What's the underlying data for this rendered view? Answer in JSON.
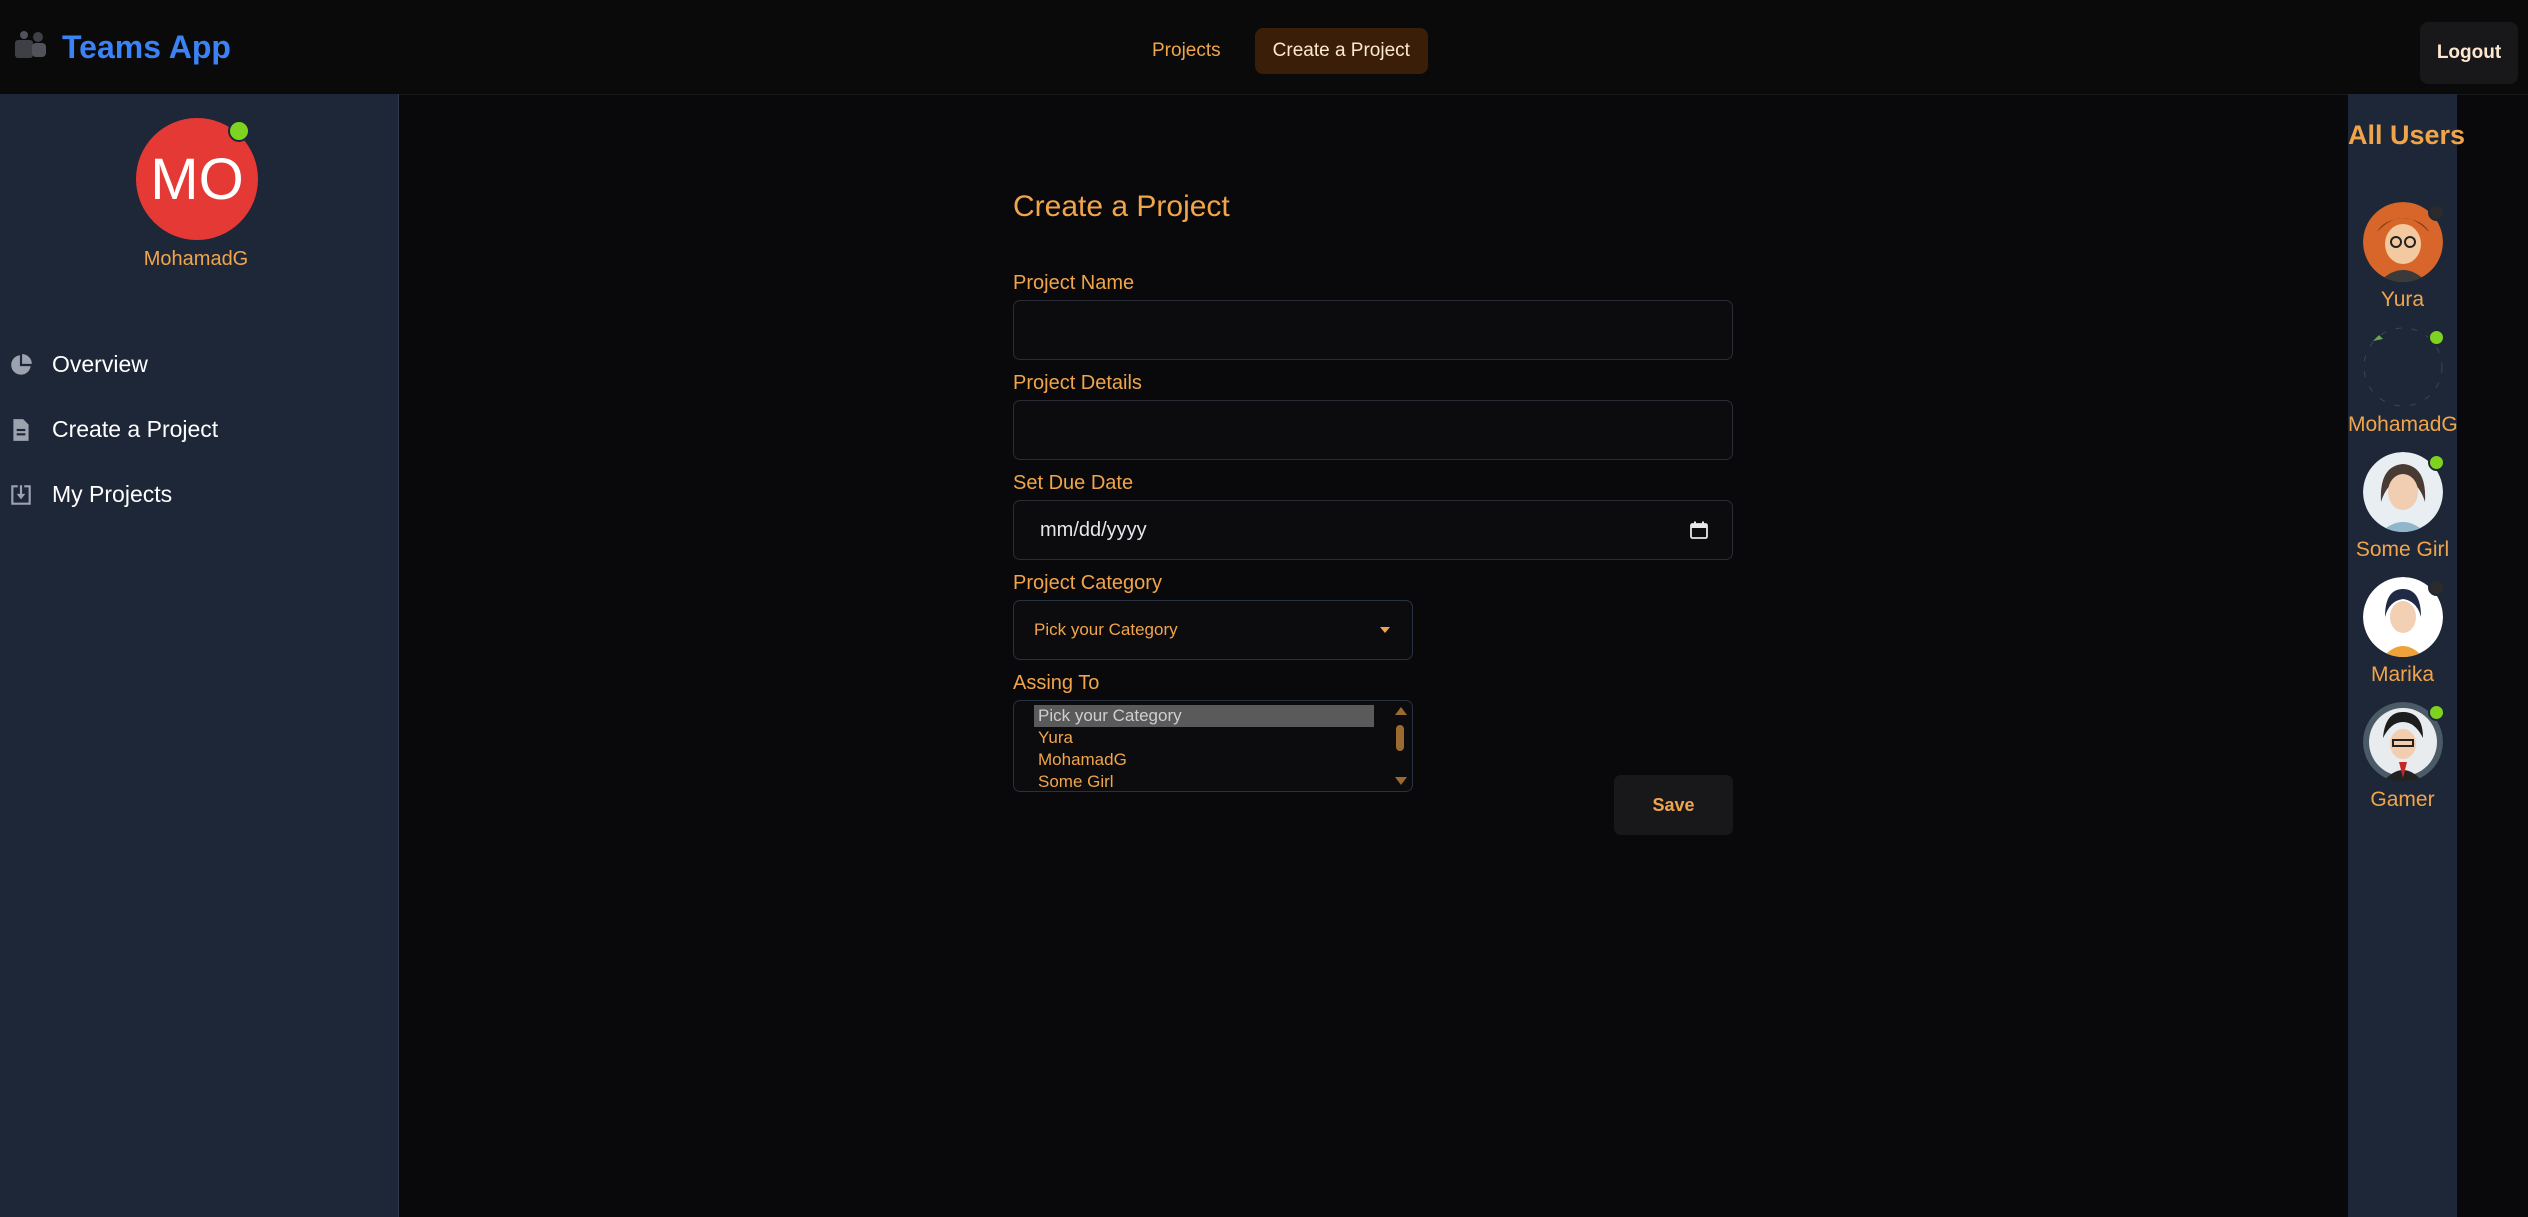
{
  "header": {
    "app_name": "Teams App",
    "nav": [
      {
        "label": "Projects",
        "active": false
      },
      {
        "label": "Create a Project",
        "active": true
      }
    ],
    "logout_label": "Logout"
  },
  "sidebar": {
    "avatar_initials": "MO",
    "avatar_color": "#e53935",
    "username": "MohamadG",
    "menu": [
      {
        "label": "Overview",
        "icon": "pie-chart-icon"
      },
      {
        "label": "Create a Project",
        "icon": "document-icon"
      },
      {
        "label": "My Projects",
        "icon": "inbox-download-icon"
      }
    ]
  },
  "form": {
    "title": "Create a Project",
    "project_name_label": "Project Name",
    "project_name_value": "",
    "project_details_label": "Project Details",
    "project_details_value": "",
    "due_date_label": "Set Due Date",
    "due_date_placeholder": "mm/dd/yyyy",
    "category_label": "Project Category",
    "category_selected": "Pick your Category",
    "assign_label": "Assing To",
    "assign_options": [
      "Pick your Category",
      "Yura",
      "MohamadG",
      "Some Girl"
    ],
    "assign_selected_index": 0,
    "save_label": "Save"
  },
  "users_panel": {
    "title": "All Users",
    "users": [
      {
        "name": "Yura",
        "online": false
      },
      {
        "name": "MohamadG",
        "online": true
      },
      {
        "name": "Some Girl",
        "online": true
      },
      {
        "name": "Marika",
        "online": false
      },
      {
        "name": "Gamer",
        "online": true
      }
    ]
  },
  "colors": {
    "accent": "#f1a54a",
    "brand": "#3b82f6",
    "online": "#7ed321",
    "offline": "#2b2b2b",
    "panel": "#1e2737",
    "background": "#09090b"
  }
}
